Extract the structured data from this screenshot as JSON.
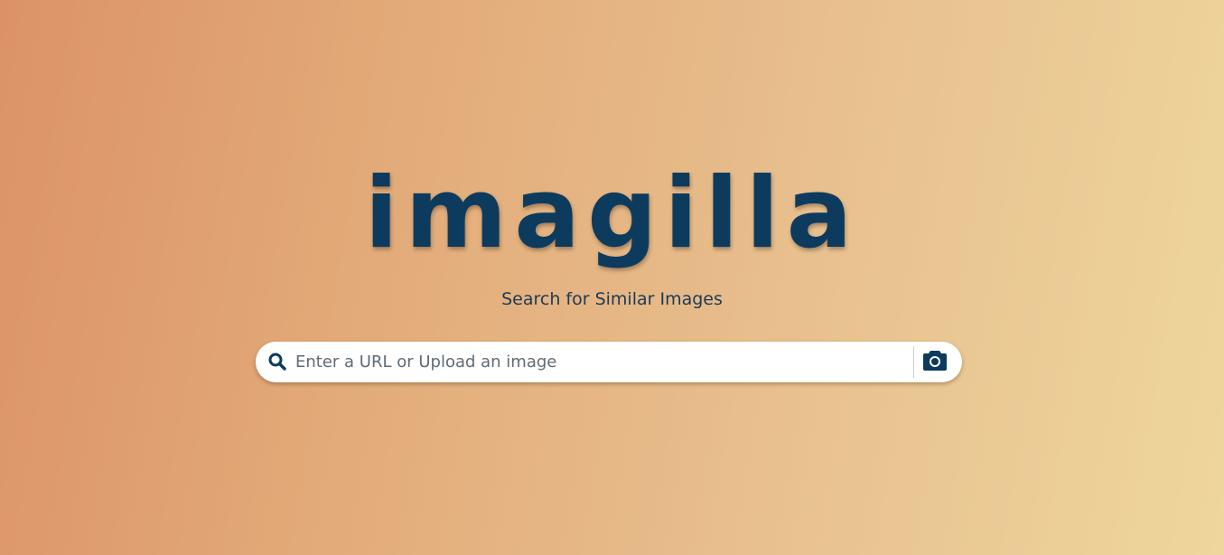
{
  "brand": {
    "logo_text": "imagilla",
    "tagline": "Search for Similar Images"
  },
  "search": {
    "placeholder": "Enter a URL or Upload an image",
    "value": "",
    "search_icon": "search-icon",
    "upload_icon": "camera-icon"
  },
  "colors": {
    "primary": "#0d3b5e",
    "gradient_start": "#dc9268",
    "gradient_end": "#eed69c",
    "search_bg": "#ffffff"
  }
}
